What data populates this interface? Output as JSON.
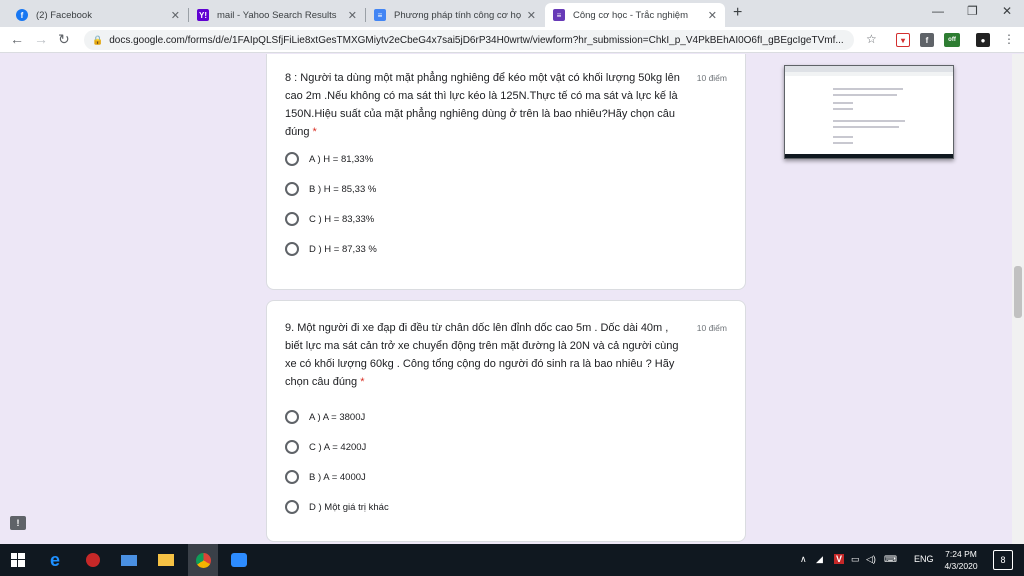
{
  "browser": {
    "tabs": [
      {
        "title": "(2) Facebook",
        "favicon": "facebook-icon",
        "color": "#1877f2",
        "glyph": "f"
      },
      {
        "title": "mail - Yahoo Search Results",
        "favicon": "yahoo-icon",
        "color": "#6001d2",
        "glyph": "Y!"
      },
      {
        "title": "Phương pháp tính công cơ học, t",
        "favicon": "docs-icon",
        "color": "#4285f4",
        "glyph": "≡"
      },
      {
        "title": "Công cơ học - Trắc nghiệm",
        "favicon": "forms-icon",
        "color": "#673ab7",
        "glyph": "≡",
        "active": true
      }
    ],
    "new_tab_symbol": "+",
    "window_controls": {
      "minimize": "—",
      "restore": "❐",
      "close": "✕"
    },
    "url": "docs.google.com/forms/d/e/1FAIpQLSfjFiLie8xtGesTMXGMiytv2eCbeG4x7sai5jD6rP34H0wrtw/viewform?hr_submission=ChkI_p_V4PkBEhAI0O6fI_gBEgcIgeTVmf...",
    "extension_off_badge": "off"
  },
  "questions": [
    {
      "text": "8 : Người ta dùng một mặt phẳng nghiêng để kéo một vật có khối lượng 50kg lên cao 2m .Nếu không có ma sát thì lực kéo là 125N.Thực tế có ma sát và lực kế là 150N.Hiệu suất của mặt phẳng nghiêng dùng ở trên là bao nhiêu?Hãy chọn câu đúng",
      "required": "*",
      "points": "10 điểm",
      "options": [
        "A ) H = 81,33%",
        "B ) H = 85,33 %",
        "C ) H = 83,33%",
        "D ) H = 87,33 %"
      ]
    },
    {
      "text": "9. Một người đi xe đạp đi đều từ chân dốc lên đỉnh dốc cao 5m . Dốc dài 40m , biết lực ma sát cản trở xe chuyển động trên mặt đường là 20N và cả người cùng xe có khối lượng 60kg . Công tổng cộng do người đó sinh ra là bao nhiêu ? Hãy chọn câu đúng",
      "required": "*",
      "points": "10 điểm",
      "options": [
        "A ) A = 3800J",
        "C ) A = 4200J",
        "B ) A = 4000J",
        "D ) Một giá trị khác"
      ]
    }
  ],
  "taskbar": {
    "lang": "ENG",
    "time": "7:24 PM",
    "date": "4/3/2020",
    "notification_count": "8"
  }
}
